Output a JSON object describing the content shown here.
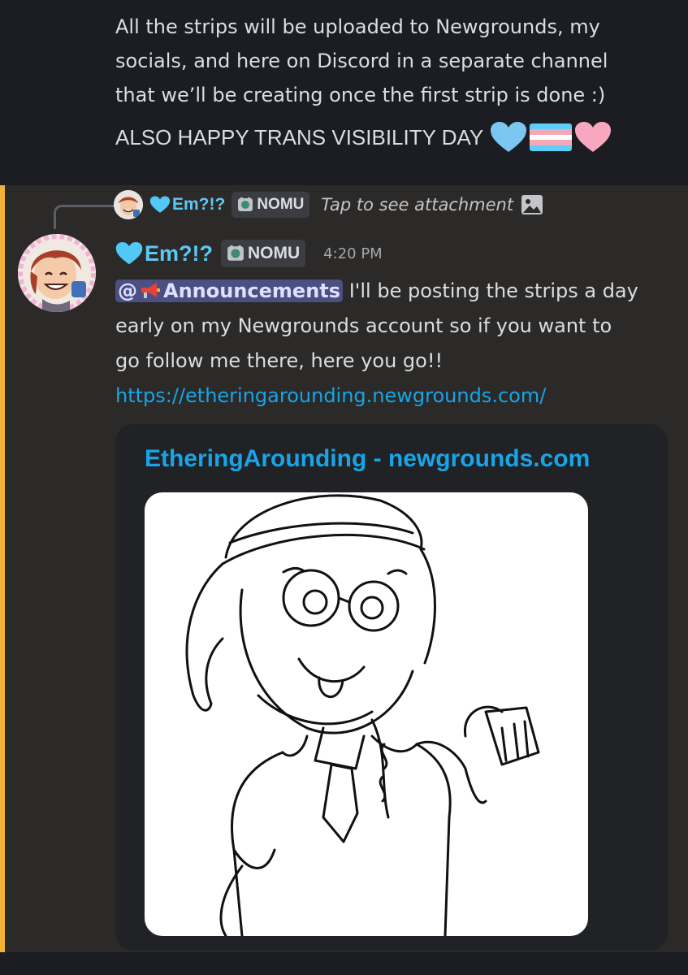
{
  "previous_message": {
    "lines": [
      "All the strips will be uploaded to Newgrounds, my",
      "socials, and here on Discord in a separate channel",
      "that we’ll be creating once the first strip is done :)"
    ],
    "caps_line": "ALSO HAPPY TRANS VISIBILITY DAY"
  },
  "reply": {
    "username": "Em?!?",
    "tag": "NOMU",
    "text": "Tap to see attachment"
  },
  "message": {
    "username": "Em?!?",
    "tag": "NOMU",
    "timestamp": "4:20 PM",
    "mention_prefix": "@",
    "mention_channel": "Announcements",
    "text_1": "I'll be posting the strips a day",
    "text_2": "early on my Newgrounds account so if you want to",
    "text_3": "go follow me there, here you go!!",
    "link": "https://etheringarounding.newgrounds.com/"
  },
  "embed": {
    "title": "EtheringArounding - newgrounds.com"
  },
  "colors": {
    "username": "#5cc8f5",
    "link": "#16a5e8",
    "mention_bar": "#f0b232",
    "mention_bg": "#4b4f82"
  }
}
